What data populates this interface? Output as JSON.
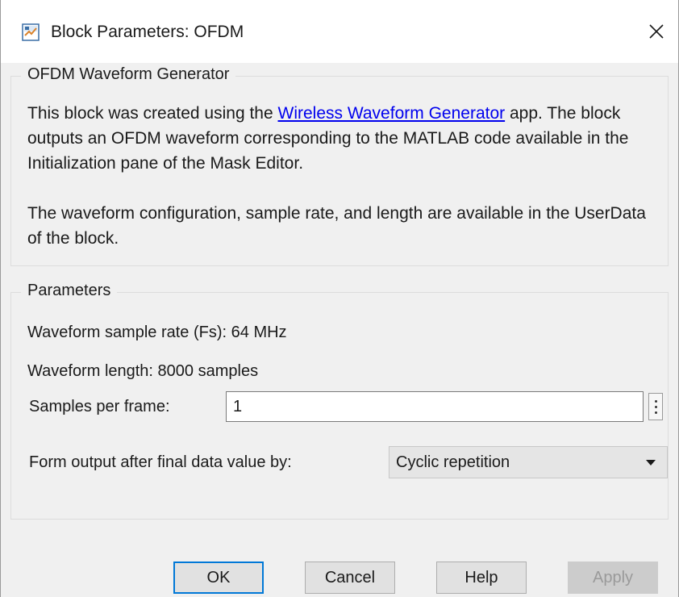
{
  "window": {
    "title": "Block Parameters: OFDM",
    "icon": "simulink-block-icon",
    "close_icon": "close-icon"
  },
  "description_group": {
    "title": "OFDM Waveform Generator",
    "para1_before_link": "This block was created using the ",
    "para1_link": "Wireless Waveform Generator",
    "para1_after_link": " app. The block outputs an OFDM waveform corresponding to the MATLAB code available in the Initialization pane of the Mask Editor.",
    "para2": "The waveform configuration, sample rate, and length are available in the UserData of the block."
  },
  "parameters_group": {
    "title": "Parameters",
    "sample_rate_text": "Waveform sample rate (Fs): 64 MHz",
    "length_text": "Waveform length: 8000 samples",
    "samples_per_frame_label": "Samples per frame:",
    "samples_per_frame_value": "1",
    "form_output_label": "Form output after final data value by:",
    "form_output_selected": "Cyclic repetition"
  },
  "buttons": {
    "ok": "OK",
    "cancel": "Cancel",
    "help": "Help",
    "apply": "Apply"
  },
  "colors": {
    "link": "#0000ee",
    "accent": "#0078d7",
    "dialog_bg": "#f0f0f0"
  }
}
